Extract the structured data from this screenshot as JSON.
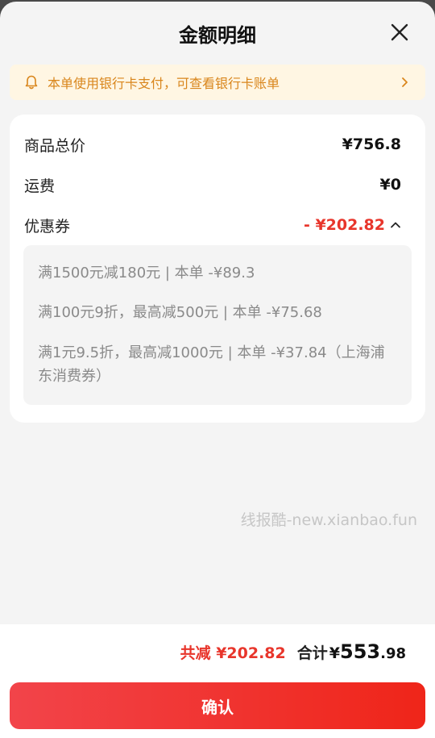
{
  "header": {
    "title": "金额明细",
    "close_icon": "close-icon"
  },
  "notice": {
    "icon": "bell-icon",
    "text": "本单使用银行卡支付，可查看银行卡账单",
    "chevron_icon": "chevron-right-icon",
    "color": "#d9861c"
  },
  "summary_rows": {
    "goods_total": {
      "label": "商品总价",
      "value": "¥756.8"
    },
    "shipping": {
      "label": "运费",
      "value": "¥0"
    },
    "coupon": {
      "label": "优惠券",
      "value": "- ¥202.82",
      "toggle_icon": "chevron-up-icon"
    }
  },
  "coupon_details": [
    "满1500元减180元 | 本单 -¥89.3",
    "满100元9折，最高减500元 | 本单 -¥75.68",
    "满1元9.5折，最高减1000元 | 本单 -¥37.84（上海浦东消费券）"
  ],
  "watermark": "线报酷-new.xianbao.fun",
  "footer": {
    "saved": "共减 ¥202.82",
    "total_label": "合计",
    "currency": "¥",
    "total_int": "553",
    "total_dec": ".98",
    "confirm_label": "确认"
  },
  "colors": {
    "accent_red": "#e8352b",
    "notice_bg": "#fff6e3"
  }
}
